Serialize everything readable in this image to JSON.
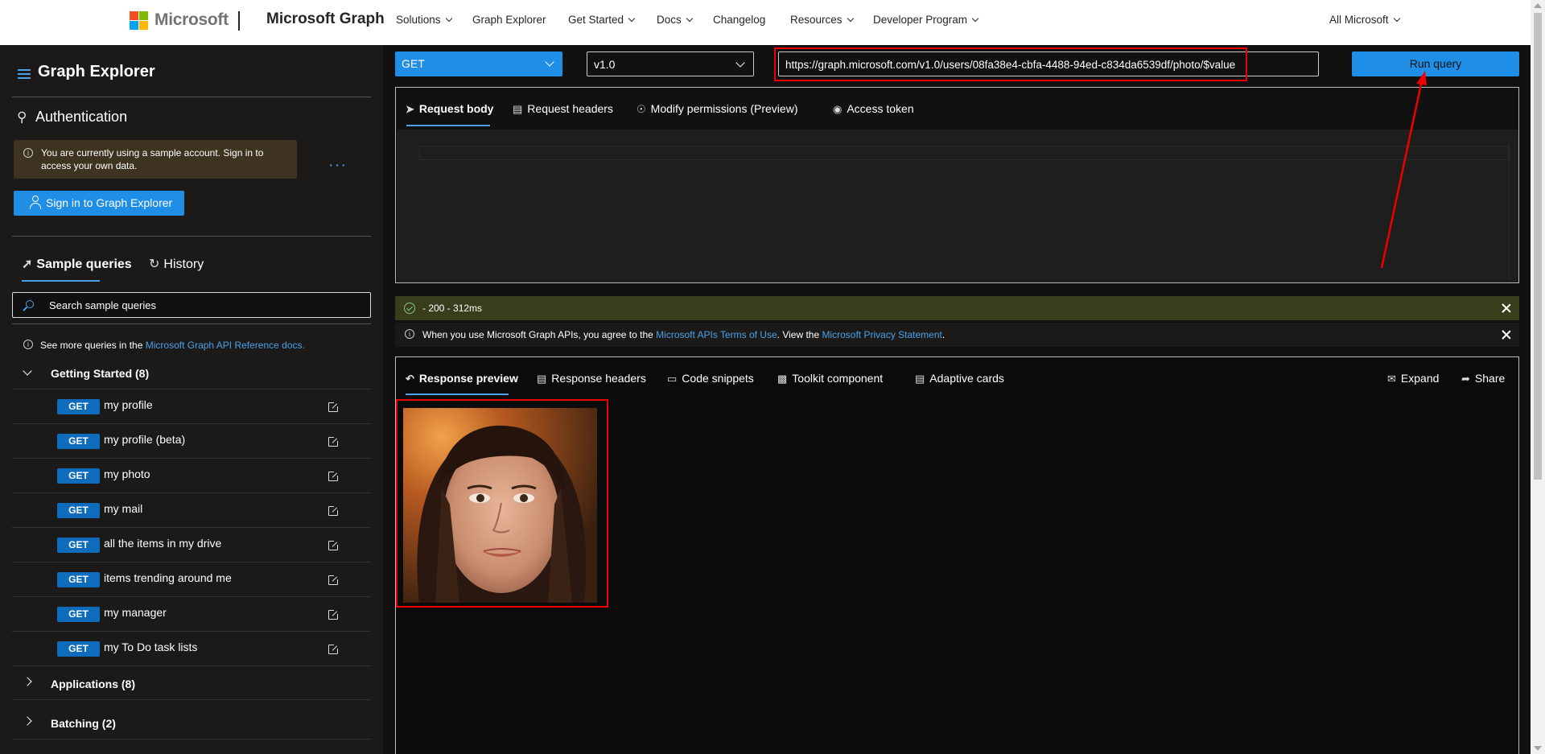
{
  "topnav": {
    "brand": "Microsoft",
    "product": "Microsoft Graph",
    "items": [
      {
        "label": "Solutions",
        "has_dropdown": true
      },
      {
        "label": "Graph Explorer",
        "has_dropdown": false
      },
      {
        "label": "Get Started",
        "has_dropdown": true
      },
      {
        "label": "Docs",
        "has_dropdown": true
      },
      {
        "label": "Changelog",
        "has_dropdown": false
      },
      {
        "label": "Resources",
        "has_dropdown": true
      },
      {
        "label": "Developer Program",
        "has_dropdown": true
      }
    ],
    "all_microsoft": "All Microsoft"
  },
  "sidebar": {
    "title": "Graph Explorer",
    "auth_title": "Authentication",
    "sample_account_msg": "You are currently using a sample account. Sign in to access your own data.",
    "more_icon": "ellipsis-icon",
    "signin_label": "Sign in to Graph Explorer",
    "tabs": [
      {
        "label": "Sample queries",
        "active": true,
        "icon": "rocket-icon"
      },
      {
        "label": "History",
        "active": false,
        "icon": "history-icon"
      }
    ],
    "search_placeholder": "Search sample queries",
    "see_more_prefix": "See more queries in the ",
    "see_more_link": "Microsoft Graph API Reference docs.",
    "categories": [
      {
        "label": "Getting Started (8)",
        "expanded": true
      },
      {
        "label": "Applications (8)",
        "expanded": false
      },
      {
        "label": "Batching (2)",
        "expanded": false
      }
    ],
    "queries": [
      {
        "method": "GET",
        "label": "my profile"
      },
      {
        "method": "GET",
        "label": "my profile (beta)"
      },
      {
        "method": "GET",
        "label": "my photo"
      },
      {
        "method": "GET",
        "label": "my mail"
      },
      {
        "method": "GET",
        "label": "all the items in my drive"
      },
      {
        "method": "GET",
        "label": "items trending around me"
      },
      {
        "method": "GET",
        "label": "my manager"
      },
      {
        "method": "GET",
        "label": "my To Do task lists"
      }
    ]
  },
  "query_bar": {
    "method": "GET",
    "version": "v1.0",
    "url": "https://graph.microsoft.com/v1.0/users/08fa38e4-cbfa-4488-94ed-c834da6539df/photo/$value",
    "run_label": "Run query"
  },
  "request_tabs": [
    {
      "label": "Request body",
      "active": true,
      "icon": "send-icon"
    },
    {
      "label": "Request headers",
      "active": false,
      "icon": "document-icon"
    },
    {
      "label": "Modify permissions (Preview)",
      "active": false,
      "icon": "shield-icon"
    },
    {
      "label": "Access token",
      "active": false,
      "icon": "lock-icon"
    }
  ],
  "status": {
    "text": " - 200 - 312ms",
    "color": "#393d1b"
  },
  "terms": {
    "prefix": "When you use Microsoft Graph APIs, you agree to the ",
    "link1": "Microsoft APIs Terms of Use",
    "middle": ". View the ",
    "link2": "Microsoft Privacy Statement",
    "suffix": "."
  },
  "response_tabs": [
    {
      "label": "Response preview",
      "active": true,
      "icon": "undo-icon"
    },
    {
      "label": "Response headers",
      "active": false,
      "icon": "document-icon"
    },
    {
      "label": "Code snippets",
      "active": false,
      "icon": "code-icon"
    },
    {
      "label": "Toolkit component",
      "active": false,
      "icon": "toolkit-icon"
    },
    {
      "label": "Adaptive cards",
      "active": false,
      "icon": "card-icon"
    }
  ],
  "response_actions": [
    {
      "label": "Expand",
      "icon": "expand-icon"
    },
    {
      "label": "Share",
      "icon": "share-icon"
    }
  ],
  "colors": {
    "accent": "#1f8ee6",
    "highlight": "#e00000"
  }
}
